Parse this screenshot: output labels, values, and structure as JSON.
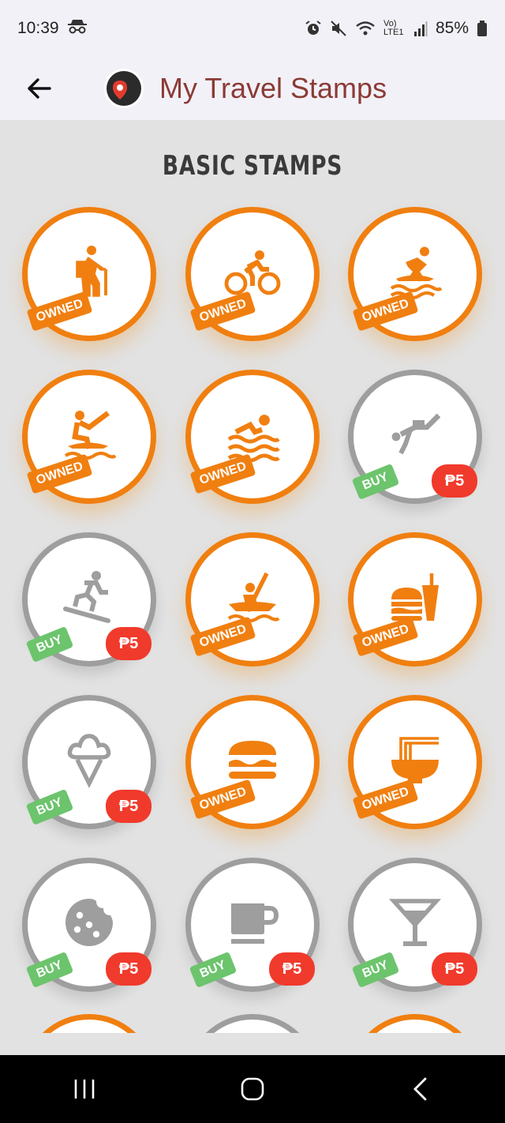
{
  "status_bar": {
    "time": "10:39",
    "battery": "85%",
    "network": "Vo) LTE1"
  },
  "app_bar": {
    "title": "My Travel Stamps"
  },
  "section": {
    "title": "BASIC STAMPS"
  },
  "badges": {
    "owned": "OWNED",
    "buy": "BUY"
  },
  "stamps": [
    {
      "name": "hiking",
      "icon": "hiking-icon",
      "status": "owned"
    },
    {
      "name": "cycling",
      "icon": "cycling-icon",
      "status": "owned"
    },
    {
      "name": "surfing",
      "icon": "surfing-icon",
      "status": "owned"
    },
    {
      "name": "kitesurfing",
      "icon": "kitesurfing-icon",
      "status": "owned"
    },
    {
      "name": "swimming",
      "icon": "swimming-icon",
      "status": "owned"
    },
    {
      "name": "scuba-diving",
      "icon": "scuba-diving-icon",
      "status": "buy",
      "price": "₱5"
    },
    {
      "name": "snowboarding",
      "icon": "snowboarding-icon",
      "status": "buy",
      "price": "₱5"
    },
    {
      "name": "kayaking",
      "icon": "kayaking-icon",
      "status": "owned"
    },
    {
      "name": "fast-food",
      "icon": "fast-food-icon",
      "status": "owned"
    },
    {
      "name": "ice-cream",
      "icon": "ice-cream-icon",
      "status": "buy",
      "price": "₱5"
    },
    {
      "name": "burger",
      "icon": "burger-icon",
      "status": "owned"
    },
    {
      "name": "ramen",
      "icon": "ramen-icon",
      "status": "owned"
    },
    {
      "name": "cookie",
      "icon": "cookie-icon",
      "status": "buy",
      "price": "₱5"
    },
    {
      "name": "coffee",
      "icon": "coffee-icon",
      "status": "buy",
      "price": "₱5"
    },
    {
      "name": "cocktail",
      "icon": "cocktail-icon",
      "status": "buy",
      "price": "₱5"
    }
  ],
  "colors": {
    "owned": "#f07f10",
    "locked_ring": "#9e9e9e",
    "locked_icon": "#9e9e9e",
    "buy_badge": "#6cc46c",
    "price_badge": "#f03a2c",
    "title": "#8b3a36"
  }
}
